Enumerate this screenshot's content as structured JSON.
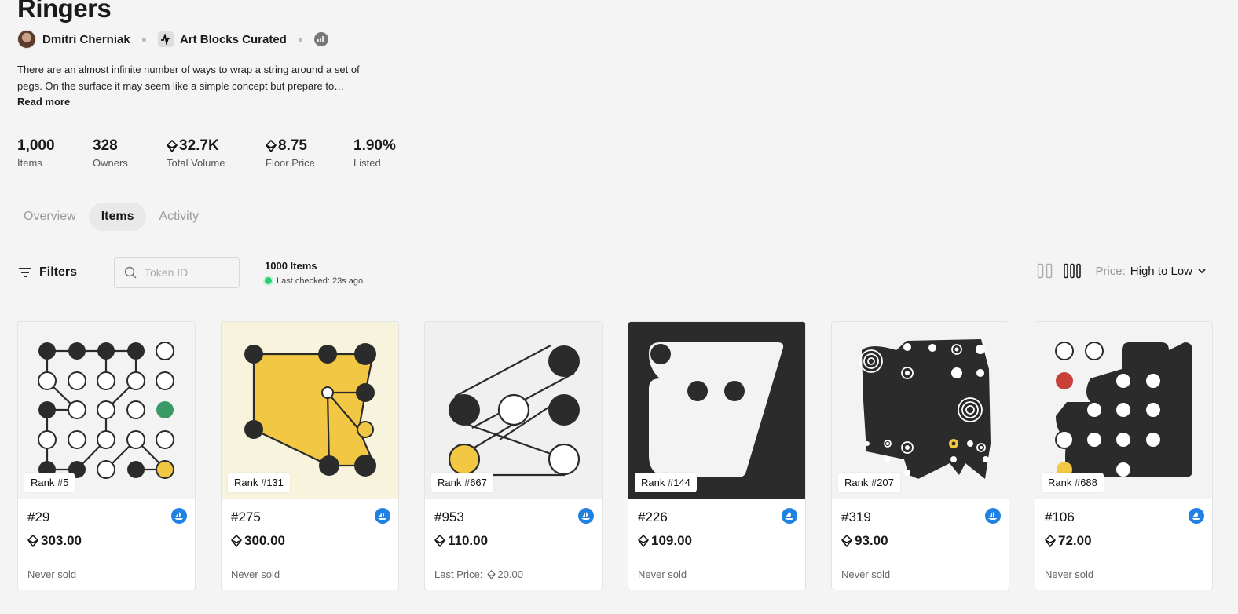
{
  "collection": {
    "title": "Ringers",
    "artist": "Dmitri Cherniak",
    "platform": "Art Blocks Curated",
    "description": "There are an almost infinite number of ways to wrap a string around a set of pegs. On the surface it may seem like a simple concept but prepare to…",
    "read_more": "Read more"
  },
  "stats": [
    {
      "value": "1,000",
      "label": "Items",
      "eth": false
    },
    {
      "value": "328",
      "label": "Owners",
      "eth": false
    },
    {
      "value": "32.7K",
      "label": "Total Volume",
      "eth": true
    },
    {
      "value": "8.75",
      "label": "Floor Price",
      "eth": true
    },
    {
      "value": "1.90%",
      "label": "Listed",
      "eth": false
    }
  ],
  "tabs": [
    "Overview",
    "Items",
    "Activity"
  ],
  "active_tab": "Items",
  "toolbar": {
    "filters_label": "Filters",
    "search_placeholder": "Token ID",
    "items_count": "1000 Items",
    "last_checked": "Last checked: 23s ago",
    "sort_label": "Price:",
    "sort_value": "High to Low"
  },
  "cards": [
    {
      "rank": "Rank #5",
      "token": "#29",
      "price": "303.00",
      "footer_prefix": "Never sold",
      "footer_eth": false,
      "footer_value": ""
    },
    {
      "rank": "Rank #131",
      "token": "#275",
      "price": "300.00",
      "footer_prefix": "Never sold",
      "footer_eth": false,
      "footer_value": ""
    },
    {
      "rank": "Rank #667",
      "token": "#953",
      "price": "110.00",
      "footer_prefix": "Last Price:",
      "footer_eth": true,
      "footer_value": "20.00"
    },
    {
      "rank": "Rank #144",
      "token": "#226",
      "price": "109.00",
      "footer_prefix": "Never sold",
      "footer_eth": false,
      "footer_value": ""
    },
    {
      "rank": "Rank #207",
      "token": "#319",
      "price": "93.00",
      "footer_prefix": "Never sold",
      "footer_eth": false,
      "footer_value": ""
    },
    {
      "rank": "Rank #688",
      "token": "#106",
      "price": "72.00",
      "footer_prefix": "Never sold",
      "footer_eth": false,
      "footer_value": ""
    }
  ],
  "colors": {
    "accent_blue": "#2081e2",
    "status_green": "#2ecc71",
    "ringer_yellow": "#f2c744",
    "ringer_dark": "#2b2b2b",
    "ringer_green": "#3a9a66",
    "ringer_red": "#c94039"
  }
}
